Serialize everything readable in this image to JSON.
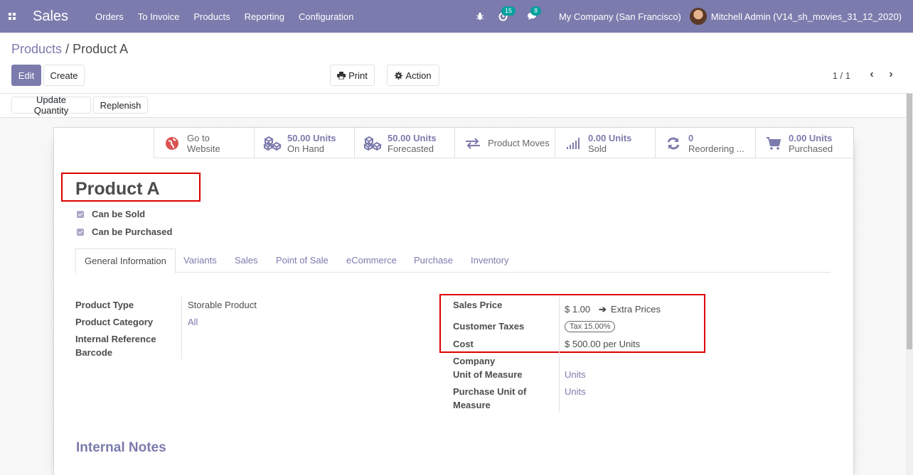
{
  "navbar": {
    "app_name": "Sales",
    "menu": [
      "Orders",
      "To Invoice",
      "Products",
      "Reporting",
      "Configuration"
    ],
    "activity_count": "15",
    "message_count": "8",
    "company": "My Company (San Francisco)",
    "user": "Mitchell Admin (V14_sh_movies_31_12_2020)"
  },
  "breadcrumb": {
    "parent": "Products",
    "separator": "/",
    "current": "Product A"
  },
  "control": {
    "edit_label": "Edit",
    "create_label": "Create",
    "print_label": "Print",
    "action_label": "Action",
    "pager": "1 / 1"
  },
  "statusbar": {
    "update_qty_label": "Update Quantity",
    "replenish_label": "Replenish"
  },
  "smart_buttons": [
    {
      "value": "Go to",
      "label": "Website",
      "icon": "globe-icon"
    },
    {
      "value": "50.00 Units",
      "label": "On Hand",
      "icon": "cubes-icon"
    },
    {
      "value": "50.00 Units",
      "label": "Forecasted",
      "icon": "cubes-icon"
    },
    {
      "value": "",
      "label": "Product Moves",
      "icon": "exchange-icon"
    },
    {
      "value": "0.00 Units",
      "label": "Sold",
      "icon": "signal-icon"
    },
    {
      "value": "0",
      "label": "Reordering ...",
      "icon": "refresh-icon"
    },
    {
      "value": "0.00 Units",
      "label": "Purchased",
      "icon": "cart-icon"
    }
  ],
  "product": {
    "name": "Product A",
    "can_be_sold": "Can be Sold",
    "can_be_purchased": "Can be Purchased"
  },
  "tabs": [
    "General Information",
    "Variants",
    "Sales",
    "Point of Sale",
    "eCommerce",
    "Purchase",
    "Inventory"
  ],
  "fields": {
    "product_type_label": "Product Type",
    "product_type_value": "Storable Product",
    "product_category_label": "Product Category",
    "product_category_value": "All",
    "internal_ref_label": "Internal Reference",
    "barcode_label": "Barcode",
    "sales_price_label": "Sales Price",
    "sales_price_value": "$ 1.00",
    "extra_prices_label": "Extra Prices",
    "customer_taxes_label": "Customer Taxes",
    "customer_taxes_value": "Tax 15.00%",
    "cost_label": "Cost",
    "cost_value": "$ 500.00",
    "cost_unit": "per Units",
    "company_label": "Company",
    "uom_label": "Unit of Measure",
    "uom_value": "Units",
    "purchase_uom_label_1": "Purchase Unit of",
    "purchase_uom_label_2": "Measure",
    "purchase_uom_value": "Units"
  },
  "notes": {
    "title": "Internal Notes"
  }
}
